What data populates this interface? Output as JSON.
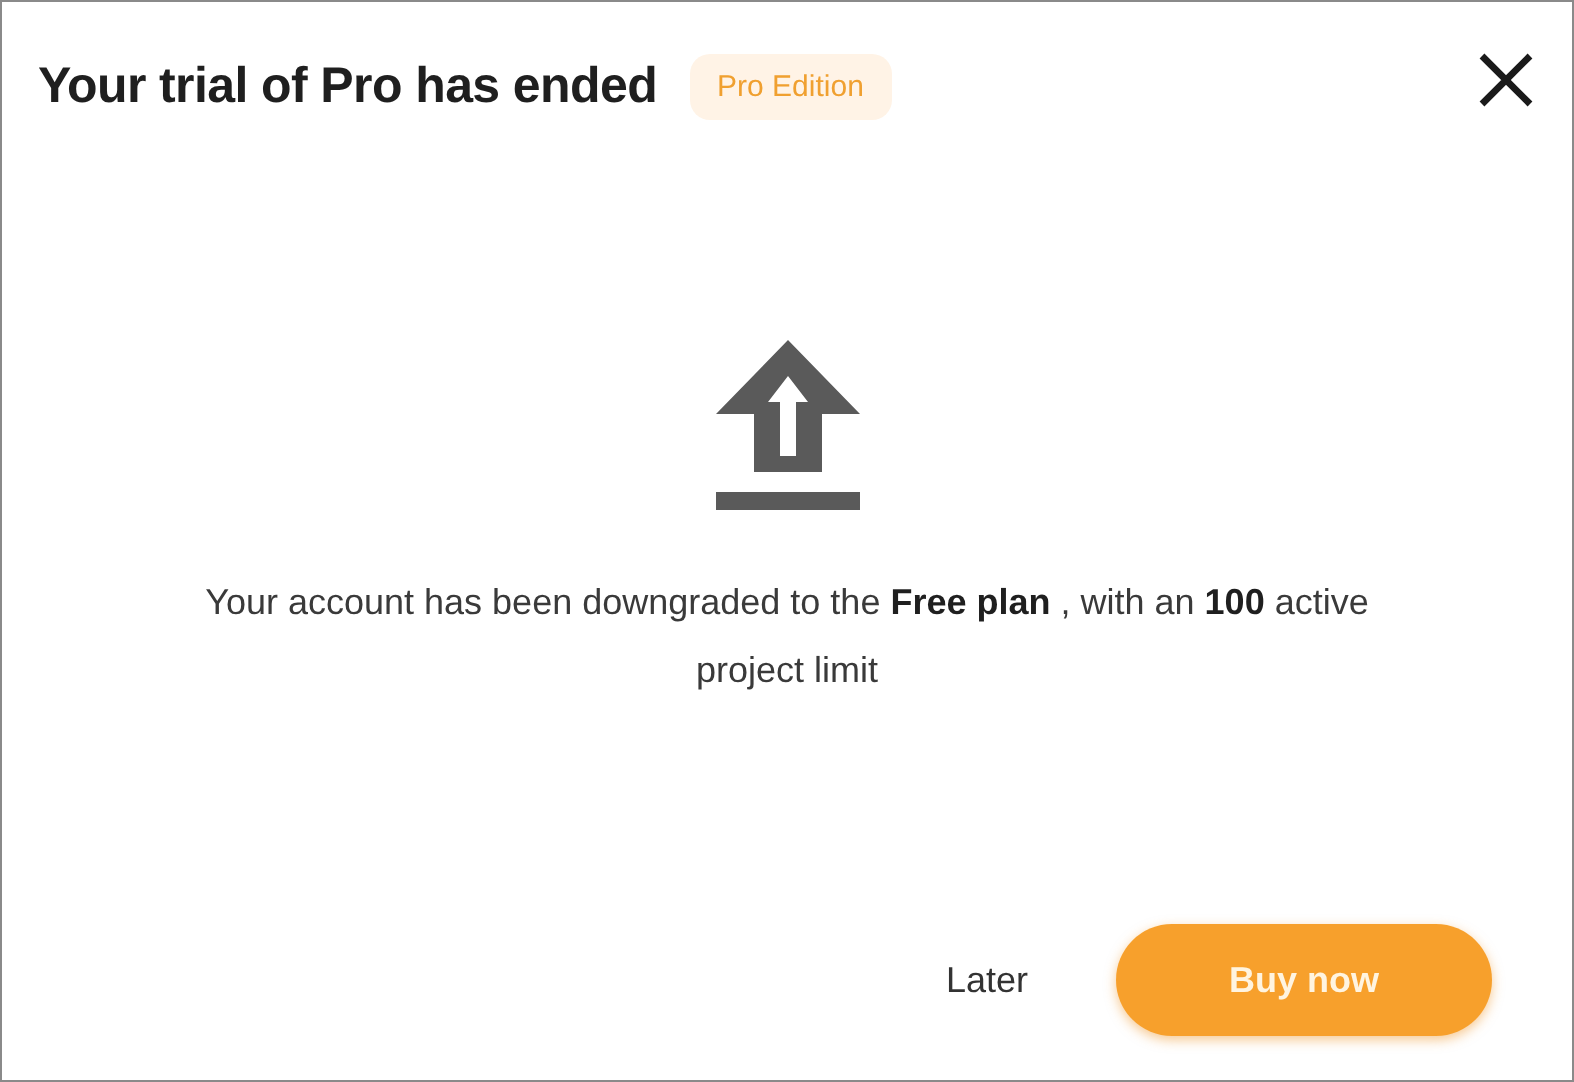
{
  "dialog": {
    "title": "Your trial of Pro has ended",
    "badge": "Pro Edition",
    "message": "Your account has been downgraded to the **Free plan** , with an **100** active project limit",
    "buttons": [
      {
        "label": "Later",
        "kind": "secondary"
      },
      {
        "label": "Buy now",
        "kind": "primary"
      }
    ]
  }
}
